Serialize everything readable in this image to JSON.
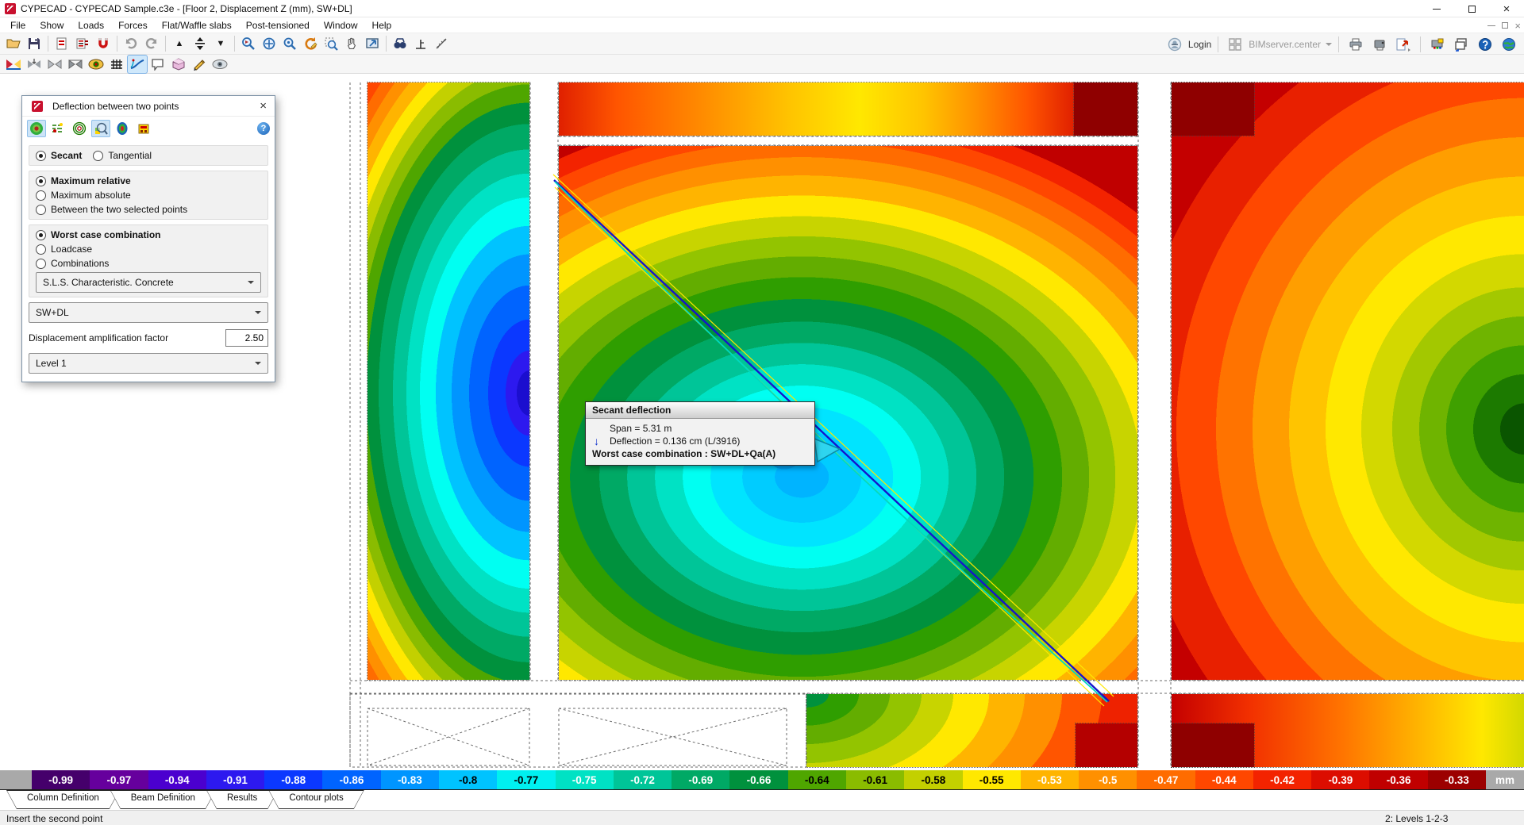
{
  "window": {
    "title": "CYPECAD - CYPECAD Sample.c3e - [Floor 2, Displacement Z (mm), SW+DL]"
  },
  "menu": {
    "items": [
      "File",
      "Show",
      "Loads",
      "Forces",
      "Flat/Waffle slabs",
      "Post-tensioned",
      "Window",
      "Help"
    ]
  },
  "topbar": {
    "login": "Login",
    "bimserver": "BIMserver.center"
  },
  "dialog": {
    "title": "Deflection between two points",
    "radio_type": [
      {
        "label": "Secant",
        "selected": true
      },
      {
        "label": "Tangential",
        "selected": false
      }
    ],
    "radio_extent": [
      {
        "label": "Maximum relative",
        "selected": true
      },
      {
        "label": "Maximum absolute",
        "selected": false
      },
      {
        "label": "Between the two selected points",
        "selected": false
      }
    ],
    "radio_case": [
      {
        "label": "Worst case combination",
        "selected": true
      },
      {
        "label": "Loadcase",
        "selected": false
      },
      {
        "label": "Combinations",
        "selected": false
      }
    ],
    "combo_combination": "S.L.S. Characteristic. Concrete",
    "combo_loadcase": "SW+DL",
    "factor_label": "Displacement amplification factor",
    "factor_value": "2.50",
    "combo_level": "Level 1"
  },
  "tooltip": {
    "title": "Secant deflection",
    "row_span": "Span = 5.31 m",
    "row_deflection": "Deflection = 0.136 cm (L/3916)",
    "row_worst": "Worst case combination : SW+DL+Qa(A)"
  },
  "scale": {
    "unit": "mm",
    "cap_color": "#a9a9a9",
    "entries": [
      {
        "label": "-0.99",
        "color": "#45006b",
        "text": "#ffffff"
      },
      {
        "label": "-0.97",
        "color": "#66009d",
        "text": "#ffffff"
      },
      {
        "label": "-0.94",
        "color": "#4b00cf",
        "text": "#ffffff"
      },
      {
        "label": "-0.91",
        "color": "#2d19ef",
        "text": "#ffffff"
      },
      {
        "label": "-0.88",
        "color": "#0b38ff",
        "text": "#ffffff"
      },
      {
        "label": "-0.86",
        "color": "#0064ff",
        "text": "#ffffff"
      },
      {
        "label": "-0.83",
        "color": "#0095ff",
        "text": "#ffffff"
      },
      {
        "label": "-0.8",
        "color": "#00c3ff",
        "text": "#000000"
      },
      {
        "label": "-0.77",
        "color": "#00f0f0",
        "text": "#000000"
      },
      {
        "label": "-0.75",
        "color": "#00e2c4",
        "text": "#ffffff"
      },
      {
        "label": "-0.72",
        "color": "#00c598",
        "text": "#ffffff"
      },
      {
        "label": "-0.69",
        "color": "#00a965",
        "text": "#ffffff"
      },
      {
        "label": "-0.66",
        "color": "#00913d",
        "text": "#ffffff"
      },
      {
        "label": "-0.64",
        "color": "#4fa600",
        "text": "#000000"
      },
      {
        "label": "-0.61",
        "color": "#8abc00",
        "text": "#000000"
      },
      {
        "label": "-0.58",
        "color": "#c3d000",
        "text": "#000000"
      },
      {
        "label": "-0.55",
        "color": "#ffe800",
        "text": "#000000"
      },
      {
        "label": "-0.53",
        "color": "#ffb400",
        "text": "#ffffff"
      },
      {
        "label": "-0.5",
        "color": "#ff9000",
        "text": "#ffffff"
      },
      {
        "label": "-0.47",
        "color": "#ff6c00",
        "text": "#ffffff"
      },
      {
        "label": "-0.44",
        "color": "#ff4700",
        "text": "#ffffff"
      },
      {
        "label": "-0.42",
        "color": "#f32300",
        "text": "#ffffff"
      },
      {
        "label": "-0.39",
        "color": "#dc0d00",
        "text": "#ffffff"
      },
      {
        "label": "-0.36",
        "color": "#c00000",
        "text": "#ffffff"
      },
      {
        "label": "-0.33",
        "color": "#9c0000",
        "text": "#ffffff"
      }
    ]
  },
  "tabs": [
    {
      "label": "Column Definition"
    },
    {
      "label": "Beam Definition"
    },
    {
      "label": "Results"
    },
    {
      "label": "Contour plots"
    }
  ],
  "status": {
    "left": "Insert the second point",
    "right": "2: Levels 1-2-3"
  }
}
